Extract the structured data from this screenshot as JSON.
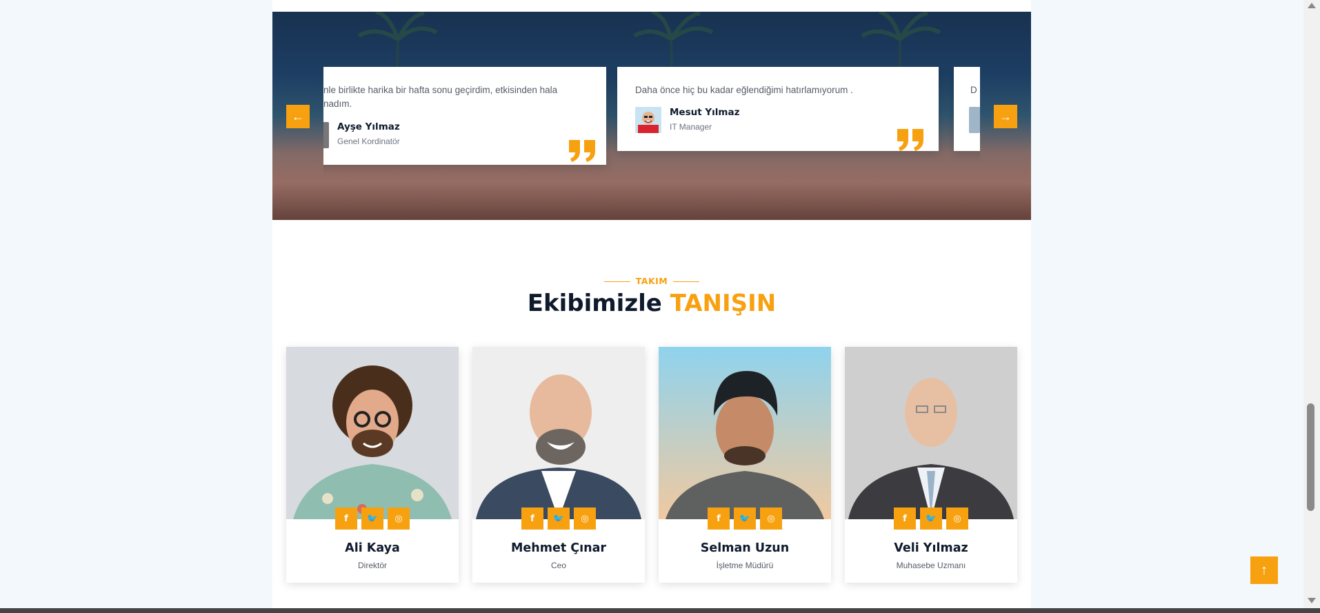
{
  "colors": {
    "accent": "#f7a111",
    "dark": "#0f1b2d",
    "muted": "#555b66"
  },
  "testimonials": [
    {
      "text": "nle birlikte harika bir hafta sonu geçirdim, etkisinden hala nadım.",
      "name": "Ayşe Yılmaz",
      "role": "Genel Kordinatör"
    },
    {
      "text": "Daha önce hiç bu kadar eğlendiğimi hatırlamıyorum .",
      "name": "Mesut Yılmaz",
      "role": "IT Manager"
    },
    {
      "text": "D"
    }
  ],
  "slider": {
    "prev_icon": "arrow-left-icon",
    "next_icon": "arrow-right-icon",
    "prev_glyph": "←",
    "next_glyph": "→"
  },
  "team": {
    "eyebrow": "TAKIM",
    "title_main": "Ekibimizle",
    "title_accent": "TANIŞIN",
    "members": [
      {
        "name": "Ali Kaya",
        "role": "Direktör"
      },
      {
        "name": "Mehmet Çınar",
        "role": "Ceo"
      },
      {
        "name": "Selman Uzun",
        "role": "İşletme Müdürü"
      },
      {
        "name": "Veli Yılmaz",
        "role": "Muhasebe Uzmanı"
      }
    ],
    "social_glyphs": {
      "facebook": "f",
      "twitter": "🐦",
      "instagram": "◎"
    }
  },
  "scroll_top": {
    "icon": "arrow-up-icon",
    "glyph": "↑"
  }
}
